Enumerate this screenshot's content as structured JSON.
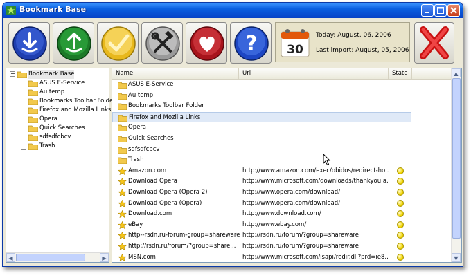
{
  "window": {
    "title": "Bookmark Base"
  },
  "toolbar": {
    "buttons": [
      "import-button",
      "export-button",
      "check-button",
      "tools-button",
      "favorites-button",
      "help-button",
      "exit-button"
    ],
    "today_text": "Today: August, 06, 2006",
    "last_import_text": "Last import: August, 05, 2006",
    "calendar_day": "30"
  },
  "tree": {
    "root": "Bookmark Base",
    "items": [
      {
        "label": "ASUS E-Service"
      },
      {
        "label": "Au temp"
      },
      {
        "label": "Bookmarks Toolbar Folder"
      },
      {
        "label": "Firefox and Mozilla Links"
      },
      {
        "label": "Opera"
      },
      {
        "label": "Quick Searches"
      },
      {
        "label": "sdfsdfcbcv"
      },
      {
        "label": "Trash"
      }
    ]
  },
  "list": {
    "columns": {
      "name": "Name",
      "url": "Url",
      "state": "State"
    },
    "rows": [
      {
        "type": "folder",
        "name": "ASUS E-Service",
        "url": "",
        "state": ""
      },
      {
        "type": "folder",
        "name": "Au temp",
        "url": "",
        "state": ""
      },
      {
        "type": "folder",
        "name": "Bookmarks Toolbar Folder",
        "url": "",
        "state": ""
      },
      {
        "type": "folder",
        "name": "Firefox and Mozilla Links",
        "url": "",
        "state": ""
      },
      {
        "type": "folder",
        "name": "Opera",
        "url": "",
        "state": ""
      },
      {
        "type": "folder",
        "name": "Quick Searches",
        "url": "",
        "state": ""
      },
      {
        "type": "folder",
        "name": "sdfsdfcbcv",
        "url": "",
        "state": ""
      },
      {
        "type": "folder",
        "name": "Trash",
        "url": "",
        "state": ""
      },
      {
        "type": "bookmark",
        "name": "Amazon.com",
        "url": "http://www.amazon.com/exec/obidos/redirect-ho...",
        "state": "yellow"
      },
      {
        "type": "bookmark",
        "name": "Download Opera",
        "url": "http://www.microsoft.com/downloads/thankyou.a...",
        "state": "yellow"
      },
      {
        "type": "bookmark",
        "name": "Download Opera (Opera 2)",
        "url": "http://www.opera.com/download/",
        "state": "yellow"
      },
      {
        "type": "bookmark",
        "name": "Download Opera (Opera)",
        "url": "http://www.opera.com/download/",
        "state": "yellow"
      },
      {
        "type": "bookmark",
        "name": "Download.com",
        "url": "http://www.download.com/",
        "state": "yellow"
      },
      {
        "type": "bookmark",
        "name": "eBay",
        "url": "http://www.ebay.com/",
        "state": "yellow"
      },
      {
        "type": "bookmark",
        "name": "http--rsdn.ru-forum-group=shareware",
        "url": "http://rsdn.ru/forum/?group=shareware",
        "state": "yellow"
      },
      {
        "type": "bookmark",
        "name": "http://rsdn.ru/forum/?group=share...",
        "url": "http://rsdn.ru/forum/?group=shareware",
        "state": "yellow"
      },
      {
        "type": "bookmark",
        "name": "MSN.com",
        "url": "http://www.microsoft.com/isapi/redir.dll?prd=ie8...",
        "state": "yellow"
      }
    ]
  },
  "colors": {
    "titlebar": "#0a5fe0",
    "window_bg": "#ece9d8",
    "state_ok": "#f2d600",
    "selection": "#dfe9f7"
  }
}
